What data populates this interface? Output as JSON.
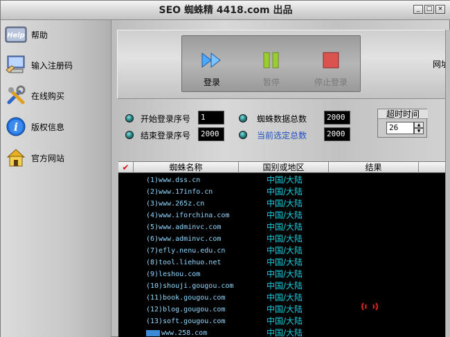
{
  "window": {
    "title": "SEO 蜘蛛精 4418.com 出品",
    "controls": [
      "_",
      "□",
      "×"
    ]
  },
  "sidebar": {
    "items": [
      {
        "label": "帮助",
        "icon": "help-icon"
      },
      {
        "label": "输入注册码",
        "icon": "computer-icon"
      },
      {
        "label": "在线购买",
        "icon": "tools-icon"
      },
      {
        "label": "版权信息",
        "icon": "info-icon"
      },
      {
        "label": "官方网站",
        "icon": "home-icon"
      }
    ]
  },
  "actions": {
    "login": "登录",
    "pause": "暂停",
    "stop": "停止登录",
    "cut_label": "网址"
  },
  "settings": {
    "start_label": "开始登录序号",
    "start_value": "1",
    "end_label": "结束登录序号",
    "end_value": "2000",
    "total_label": "蜘蛛数据总数",
    "total_value": "2000",
    "selected_label": "当前选定总数",
    "selected_value": "2000",
    "timeout_label": "超时时间",
    "timeout_value": "26"
  },
  "table": {
    "check_mark": "✔",
    "columns": [
      "蜘蛛名称",
      "国别或地区",
      "结果"
    ],
    "rows": [
      {
        "name": "(1)www.dss.cn",
        "region": "中国/大陆"
      },
      {
        "name": "(2)www.17info.cn",
        "region": "中国/大陆"
      },
      {
        "name": "(3)www.265z.cn",
        "region": "中国/大陆"
      },
      {
        "name": "(4)www.iforchina.com",
        "region": "中国/大陆"
      },
      {
        "name": "(5)www.adminvc.com",
        "region": "中国/大陆"
      },
      {
        "name": "(6)www.adminvc.com",
        "region": "中国/大陆"
      },
      {
        "name": "(7)efly.nenu.edu.cn",
        "region": "中国/大陆"
      },
      {
        "name": "(8)tool.liehuo.net",
        "region": "中国/大陆"
      },
      {
        "name": "(9)leshou.com",
        "region": "中国/大陆"
      },
      {
        "name": "(10)shouji.gougou.com",
        "region": "中国/大陆"
      },
      {
        "name": "(11)book.gougou.com",
        "region": "中国/大陆"
      },
      {
        "name": "(12)blog.gougou.com",
        "region": "中国/大陆"
      },
      {
        "name": "(13)soft.gougou.com",
        "region": "中国/大陆"
      },
      {
        "name": "www.258.com",
        "region": "中国/大陆"
      }
    ]
  },
  "colors": {
    "accent_blue": "#4aa8ff",
    "pause_green": "#9acd32",
    "stop_red": "#d9534f",
    "region_cyan": "#1ad0e0",
    "check_red": "#cc1111",
    "radar_red": "#e02020"
  }
}
